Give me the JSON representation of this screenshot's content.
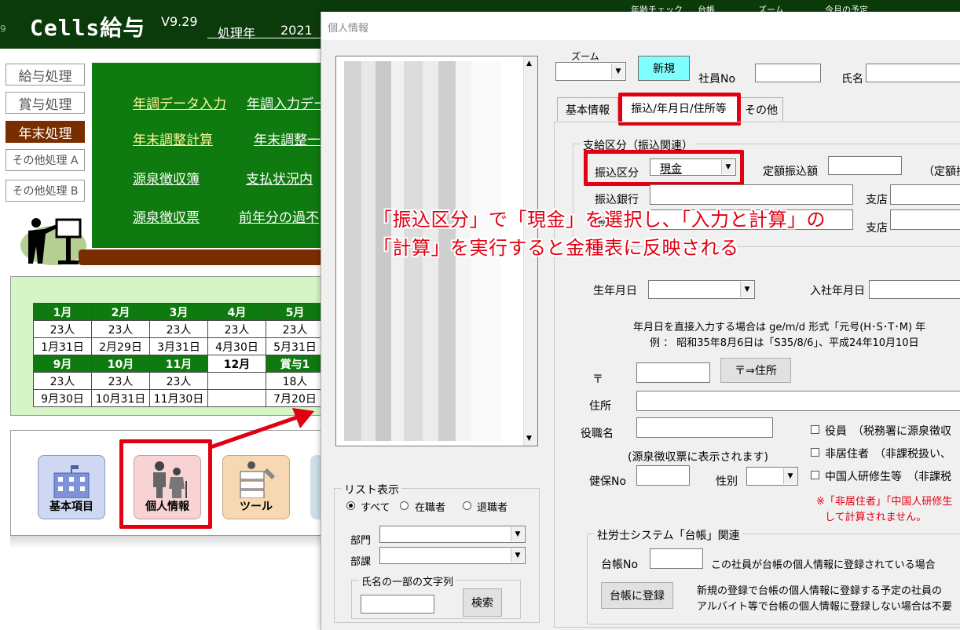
{
  "app": {
    "num": "9",
    "title": "Cells給与",
    "version": "V9.29",
    "proc_year_label": "処理年",
    "proc_year": "2021",
    "top_menu": [
      "年齢チェック",
      "台帳",
      "ズーム",
      "今月の予定"
    ]
  },
  "sidebar": [
    "給与処理",
    "賞与処理",
    "年末処理",
    "その他処理 A",
    "その他処理 B"
  ],
  "board_links": [
    [
      "年調データ入力",
      "年調入力デー"
    ],
    [
      "年末調整計算",
      "年末調整一"
    ],
    [
      "源泉徴収簿",
      "支払状況内"
    ],
    [
      "源泉徴収票",
      "前年分の過不"
    ]
  ],
  "calendar": {
    "row1_months": [
      "1月",
      "2月",
      "3月",
      "4月",
      "5月"
    ],
    "row1_people": [
      "23人",
      "23人",
      "23人",
      "23人",
      "23人"
    ],
    "row1_dates": [
      "1月31日",
      "2月29日",
      "3月31日",
      "4月30日",
      "5月31日"
    ],
    "row2_months": [
      "9月",
      "10月",
      "11月",
      "12月",
      "賞与1"
    ],
    "row2_people": [
      "23人",
      "23人",
      "23人",
      "",
      "18人"
    ],
    "row2_dates": [
      "9月30日",
      "10月31日",
      "11月30日",
      "",
      "7月20日"
    ]
  },
  "tiles": {
    "basic": "基本項目",
    "personal": "個人情報",
    "tool": "ツール"
  },
  "dialog": {
    "title": "個人情報",
    "zoom_label": "ズーム",
    "new_button": "新規",
    "emp_no_label": "社員No",
    "name_label": "氏名",
    "tabs": [
      "基本情報",
      "振込/年月日/住所等",
      "その他"
    ],
    "pay_group_title": "支給区分（振込関連）",
    "pay_type_label": "振込区分",
    "pay_type_value": "現金",
    "fixed_amount_label": "定額振込額",
    "fixed_note": "（定額振",
    "bank_label": "振込銀行",
    "branch_label": "支店",
    "bank2_label": "振込",
    "branch2_label": "支店",
    "birth_label": "生年月日",
    "hire_label": "入社年月日",
    "date_hint_1": "年月日を直接入力する場合は ge/m/d  形式「元号(H･S･T･M)  年",
    "date_hint_2": "例  ：  昭和35年8月6日は「S35/8/6」、平成24年10月10日",
    "postal_label": "〒",
    "postal_button": "〒⇒住所",
    "address_label": "住所",
    "position_label": "役職名",
    "position_note": "(源泉徴収票に表示されます)",
    "officer_label": "役員　（税務署に源泉徴収",
    "nonresident_label": "非居住者　（非課税扱い、",
    "trainee_label": "中国人研修生等　（非課税",
    "insurance_label": "健保No",
    "gender_label": "性別",
    "red_note_1": "※「非居住者」「中国人研修生",
    "red_note_2": "して計算されません。",
    "ledger_group_title": "社労士システム「台帳」関連",
    "ledger_no_label": "台帳No",
    "ledger_note": "この社員が台帳の個人情報に登録されている場合",
    "ledger_button": "台帳に登録",
    "ledger_desc_1": "新規の登録で台帳の個人情報に登録する予定の社員の",
    "ledger_desc_2": "アルバイト等で台帳の個人情報に登録しない場合は不要",
    "list_group_title": "リスト表示",
    "radio_all": "すべて",
    "radio_current": "在職者",
    "radio_retired": "退職者",
    "dept_label": "部門",
    "section_label": "部課",
    "name_search_group": "氏名の一部の文字列",
    "search_button": "検索"
  },
  "annotation": {
    "line1": "「振込区分」で「現金」を選択し、「入力と計算」の",
    "line2": "「計算」を実行すると金種表に反映される"
  },
  "colors": {
    "annotation_red": "#e00012",
    "board_green": "#0f7a0f",
    "top_green": "#0b3b0b",
    "active_brown": "#7a2e00",
    "new_button": "#80ffff"
  }
}
